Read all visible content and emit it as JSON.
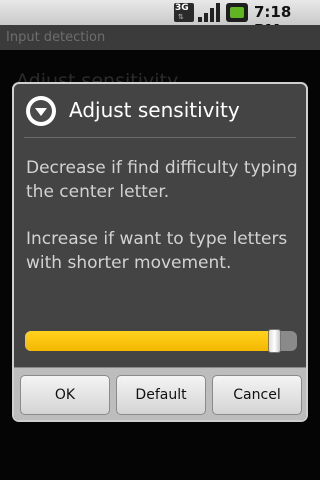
{
  "status_bar": {
    "network_label": "3G",
    "time": "7:18 PM",
    "icons": [
      "3g-data-icon",
      "signal-strength-icon",
      "battery-icon"
    ]
  },
  "activity": {
    "title": "Input detection",
    "behind_item": "Adjust sensitivity"
  },
  "dialog": {
    "icon": "dropdown-circle-icon",
    "title": "Adjust sensitivity",
    "text1": "Decrease if find difficulty typing the center letter.",
    "text2": "Increase if want to type letters with shorter movement.",
    "slider": {
      "value": 0.94,
      "fill_color": "#f5b800"
    },
    "buttons": {
      "ok": "OK",
      "default": "Default",
      "cancel": "Cancel"
    }
  }
}
